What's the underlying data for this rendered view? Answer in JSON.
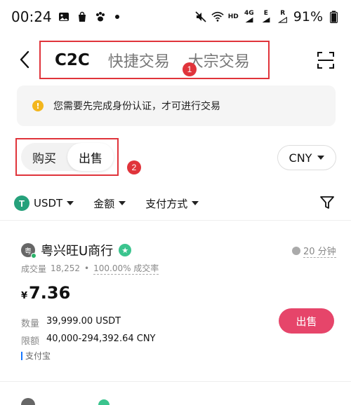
{
  "status_bar": {
    "time": "00:24",
    "network_hd": "HD",
    "network_4g": "4G",
    "network_e": "E",
    "network_r": "R",
    "battery": "91%"
  },
  "header": {
    "tabs": [
      {
        "label": "C2C",
        "active": true
      },
      {
        "label": "快捷交易",
        "active": false
      },
      {
        "label": "大宗交易",
        "active": false
      }
    ],
    "marker_1": "1"
  },
  "notice": {
    "icon": "!",
    "text": "您需要先完成身份认证，才可进行交易"
  },
  "trade_toggle": {
    "buy": "购买",
    "sell": "出售",
    "selected": "出售",
    "marker_2": "2"
  },
  "currency": {
    "selected": "CNY"
  },
  "filters": {
    "coin": "USDT",
    "coin_icon_letter": "T",
    "amount": "金额",
    "payment": "支付方式"
  },
  "listing": {
    "merchant": "粤兴旺U商行",
    "avatar_letter": "粤",
    "time_limit": "20 分钟",
    "volume_label": "成交量",
    "volume": "18,252",
    "separator": "•",
    "completion_rate": "100.00% 成交率",
    "currency_symbol": "¥",
    "price": "7.36",
    "quantity_label": "数量",
    "quantity": "39,999.00 USDT",
    "limit_label": "限额",
    "limit": "40,000-294,392.64 CNY",
    "payment_method": "支付宝",
    "action": "出售"
  },
  "colors": {
    "annotation_red": "#e0343b",
    "sell_button": "#e6456a",
    "usdt_green": "#26a17b",
    "notice_bg": "#f5f5f5"
  }
}
